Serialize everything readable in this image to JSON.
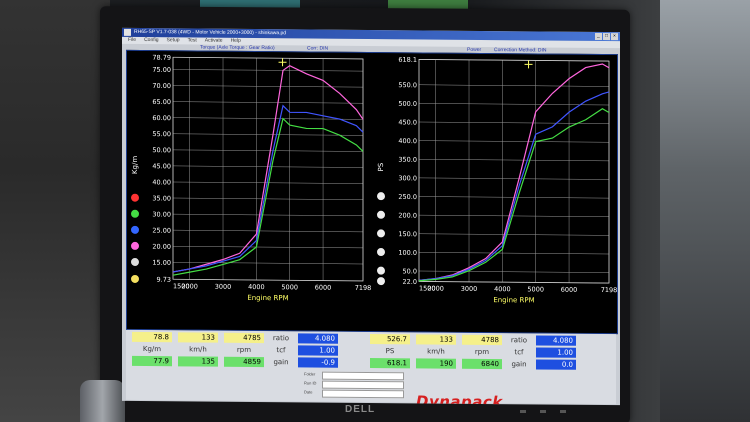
{
  "window": {
    "title": "RH65-SP V1.7-038    (4WD - Motor Vehicle 2000+3000) - shinkawa.pd",
    "menu": [
      "File",
      "Config",
      "Setup",
      "Test",
      "Activate",
      "Help"
    ]
  },
  "graph_headers": {
    "left_title": "Torque (Axle Torque : Gear Ratio)",
    "left_corr": "Corr: DIN",
    "right_title": "Power",
    "right_corr": "Correction Method: DIN"
  },
  "chart_data": [
    {
      "type": "line",
      "title": "Torque (Axle Torque : Gear Ratio)",
      "xlabel": "Engine RPM",
      "ylabel": "Kg/m",
      "xlim": [
        1500,
        7198
      ],
      "ylim": [
        9.73,
        78.79
      ],
      "x_ticks": [
        "1500",
        "2000",
        "3000",
        "4000",
        "5000",
        "6000",
        "7198"
      ],
      "y_ticks": [
        "78.79",
        "75.00",
        "70.00",
        "65.00",
        "60.00",
        "55.00",
        "50.00",
        "45.00",
        "40.00",
        "35.00",
        "30.00",
        "25.00",
        "20.00",
        "15.00",
        "9.73"
      ],
      "series": [
        {
          "color": "#ff66dd",
          "x": [
            1500,
            2000,
            2500,
            3000,
            3500,
            4000,
            4500,
            4800,
            5000,
            5500,
            6000,
            6500,
            7000,
            7198
          ],
          "y": [
            12,
            13,
            14.5,
            16,
            18,
            24,
            55,
            75,
            76.5,
            74,
            72,
            68,
            63,
            60
          ]
        },
        {
          "color": "#4055ff",
          "x": [
            1500,
            2000,
            2500,
            3000,
            3500,
            4000,
            4500,
            4800,
            5000,
            5500,
            6000,
            6500,
            7000,
            7198
          ],
          "y": [
            12,
            13,
            14,
            15.5,
            17,
            22,
            50,
            64,
            62,
            62,
            61,
            60,
            58,
            56
          ]
        },
        {
          "color": "#44dd44",
          "x": [
            1500,
            2000,
            2500,
            3000,
            3500,
            4000,
            4500,
            4800,
            5000,
            5500,
            6000,
            6500,
            7000,
            7198
          ],
          "y": [
            11,
            12,
            13,
            14.5,
            16,
            20,
            47,
            60,
            58,
            57,
            57,
            55,
            52,
            50
          ]
        }
      ],
      "cursor_x": 4785,
      "side_values": [
        "35.00",
        "30.00",
        "25.00",
        "20.00",
        "15.00",
        "9.73"
      ]
    },
    {
      "type": "line",
      "title": "Power",
      "xlabel": "Engine RPM",
      "ylabel": "PS",
      "xlim": [
        1500,
        7198
      ],
      "ylim": [
        22.0,
        618.1
      ],
      "x_ticks": [
        "1500",
        "2000",
        "3000",
        "4000",
        "5000",
        "6000",
        "7198"
      ],
      "y_ticks": [
        "618.1",
        "550.0",
        "500.0",
        "450.0",
        "400.0",
        "350.0",
        "300.0",
        "250.0",
        "200.0",
        "150.0",
        "100.0",
        "50.0",
        "22.0"
      ],
      "series": [
        {
          "color": "#ff66dd",
          "x": [
            1500,
            2000,
            2500,
            3000,
            3500,
            4000,
            4500,
            5000,
            5500,
            6000,
            6500,
            7000,
            7198
          ],
          "y": [
            25,
            30,
            40,
            60,
            85,
            130,
            300,
            480,
            530,
            570,
            600,
            610,
            600
          ]
        },
        {
          "color": "#4055ff",
          "x": [
            1500,
            2000,
            2500,
            3000,
            3500,
            4000,
            4500,
            5000,
            5500,
            6000,
            6500,
            7000,
            7198
          ],
          "y": [
            25,
            30,
            38,
            56,
            80,
            120,
            280,
            420,
            440,
            480,
            510,
            530,
            535
          ]
        },
        {
          "color": "#44dd44",
          "x": [
            1500,
            2000,
            2500,
            3000,
            3500,
            4000,
            4500,
            5000,
            5500,
            6000,
            6500,
            7000,
            7198
          ],
          "y": [
            24,
            28,
            35,
            52,
            75,
            110,
            260,
            400,
            410,
            440,
            460,
            490,
            480
          ]
        }
      ],
      "cursor_x": 4785,
      "side_values": [
        "250.0",
        "200.0",
        "150.0",
        "100.0",
        "50.0",
        "22.0"
      ]
    }
  ],
  "readouts": {
    "row1_left": [
      "78.8",
      "133",
      "4785"
    ],
    "row1_left_label": "ratio",
    "row1_left_value": "4.080",
    "units_left": [
      "Kg/m",
      "km/h",
      "rpm"
    ],
    "tcf_label": "tcf",
    "tcf_left": "1.00",
    "row2_left": [
      "77.9",
      "135",
      "4859"
    ],
    "gain_label": "gain",
    "gain_left": "-0.9",
    "row1_right": [
      "526.7",
      "133",
      "4788"
    ],
    "row1_right_label": "ratio",
    "row1_right_value": "4.080",
    "units_right": [
      "PS",
      "km/h",
      "rpm"
    ],
    "tcf_right": "1.00",
    "row2_right": [
      "618.1",
      "190",
      "6840"
    ],
    "gain_right": "0.0"
  },
  "file_fields": {
    "labels": [
      "Folder",
      "Run ID",
      "Date"
    ]
  },
  "brand": {
    "logo": "Dynapack",
    "monitor": "DELL"
  }
}
